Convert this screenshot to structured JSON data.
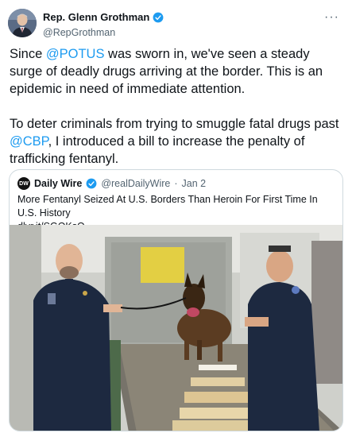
{
  "tweet": {
    "author_name": "Rep. Glenn Grothman",
    "author_handle": "@RepGrothman",
    "more_icon": "more-icon",
    "text_p1_before": "Since ",
    "text_p1_mention": "@POTUS",
    "text_p1_after": " was sworn in, we've seen a steady surge of deadly drugs arriving at the border. This is an epidemic in need of immediate attention.",
    "text_p2_before": "To deter criminals from trying to smuggle fatal drugs past ",
    "text_p2_mention": "@CBP",
    "text_p2_after": ", I introduced a bill to increase the penalty of trafficking fentanyl."
  },
  "quote": {
    "logo_text": "DW",
    "name": "Daily Wire",
    "handle": "@realDailyWire",
    "separator": "·",
    "date": "Jan 2",
    "headline": "More Fentanyl Seized At U.S. Borders Than Heroin For First Time In U.S. History",
    "link": "dlvr.it/SGQKsQ"
  },
  "colors": {
    "accent": "#1d9bf0",
    "text": "#0f1419",
    "secondary": "#536471"
  }
}
